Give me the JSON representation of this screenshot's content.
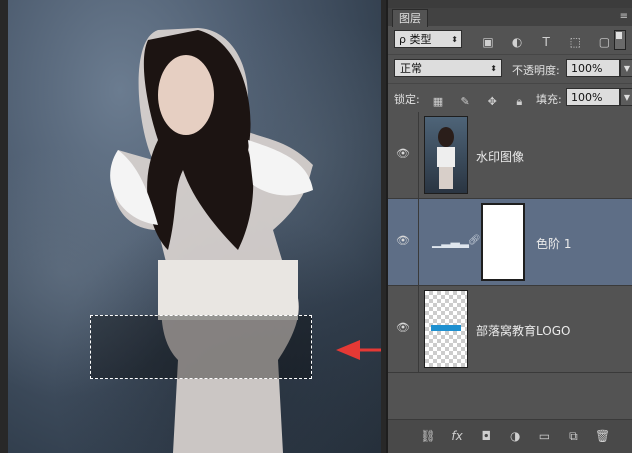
{
  "panel": {
    "tab_label": "图层",
    "filter_label": "ρ 类型",
    "blend_mode": "正常",
    "opacity_label": "不透明度:",
    "opacity_value": "100%",
    "lock_label": "锁定:",
    "fill_label": "填充:",
    "fill_value": "100%"
  },
  "layers": [
    {
      "name": "水印图像",
      "selected": false,
      "type": "image"
    },
    {
      "name": "色阶 1",
      "selected": true,
      "type": "adjustment"
    },
    {
      "name": "部落窝教育LOGO",
      "selected": false,
      "type": "logo"
    }
  ],
  "colors": {
    "panel_bg": "#535353",
    "selected_layer": "#5e6e86",
    "arrow": "#e53935"
  },
  "icons": [
    "eye-icon",
    "link-icon",
    "fx-icon",
    "mask-icon",
    "adjustment-icon",
    "folder-icon",
    "new-layer-icon",
    "trash-icon"
  ]
}
